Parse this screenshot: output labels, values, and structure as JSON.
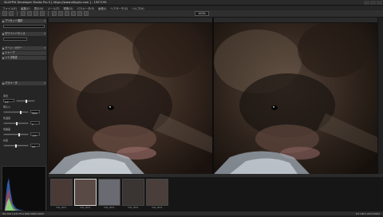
{
  "app": {
    "title": "SILKYPIX Developer Studio Pro 5 [ https://www.silkypix.com ] - 1957199"
  },
  "menu": [
    "ファイル(F)",
    "編集(E)",
    "表示(V)",
    "ツール(T)",
    "現像(D)",
    "パラメータ(P)",
    "画像(I)",
    "ヘアサーチ(S)",
    "ヘルプ(H)"
  ],
  "toolbar": {
    "zoom": "100%"
  },
  "left": {
    "sec1": "プリセット選択",
    "sec2": "ホワイトバランス",
    "sec3": "トーン・カラー",
    "sec4": "シャープ",
    "sec5": "ノイズ除去",
    "sec6": "パラメータ",
    "rows": [
      "露出",
      "明るさ",
      "色温度",
      "色偏差",
      "彩度",
      "シャドウ",
      "ハイライト"
    ],
    "values": [
      "0.0",
      "5500",
      "0",
      "+12",
      "0.0"
    ]
  },
  "filmstrip": {
    "thumbs": [
      {
        "name": "IMG_0001"
      },
      {
        "name": "IMG_0002"
      },
      {
        "name": "IMG_0003"
      },
      {
        "name": "IMG_0004"
      },
      {
        "name": "IMG_0005"
      }
    ]
  },
  "status": {
    "left": "ISO 100  1/125  F5.6  RAW  6000×4000",
    "right": "1/5  100%  2017/03/04"
  },
  "colors": {
    "accent": "#d0d0d0",
    "panel": "#252525"
  }
}
